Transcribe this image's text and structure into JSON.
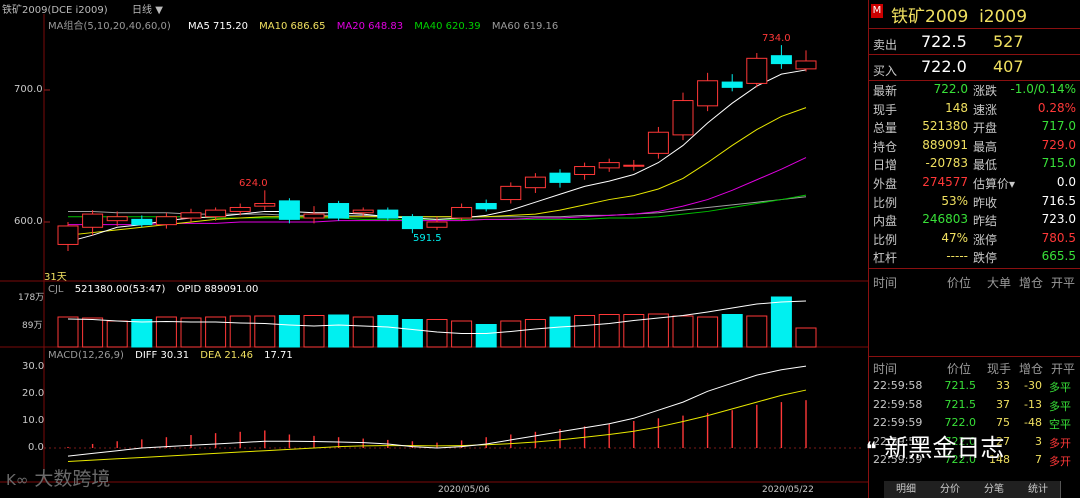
{
  "window": {
    "title": "铁矿2009(DCE i2009)",
    "period": "日线",
    "period_arrow": "▼"
  },
  "chart": {
    "ma_group": "MA组合(5,10,20,40,60,0)",
    "ma5": "MA5 715.20",
    "ma10": "MA10 686.65",
    "ma20": "MA20 648.83",
    "ma40": "MA40 620.39",
    "ma60": "MA60 619.16",
    "y_labels": [
      "700.0",
      "600.0"
    ],
    "hi_label": "734.0",
    "mark_624": "624.0",
    "low_label": "591.5",
    "days_label": "31天",
    "candles": [
      {
        "o": 583,
        "c": 597,
        "h": 600,
        "l": 578
      },
      {
        "o": 596,
        "c": 606,
        "h": 609,
        "l": 590
      },
      {
        "o": 601,
        "c": 604,
        "h": 608,
        "l": 597
      },
      {
        "o": 602,
        "c": 598,
        "h": 605,
        "l": 596
      },
      {
        "o": 598,
        "c": 604,
        "h": 607,
        "l": 595
      },
      {
        "o": 603,
        "c": 607,
        "h": 610,
        "l": 600
      },
      {
        "o": 604,
        "c": 609,
        "h": 611,
        "l": 601
      },
      {
        "o": 608,
        "c": 611,
        "h": 614,
        "l": 605
      },
      {
        "o": 612,
        "c": 614,
        "h": 624,
        "l": 609
      },
      {
        "o": 616,
        "c": 602,
        "h": 618,
        "l": 599
      },
      {
        "o": 603,
        "c": 606,
        "h": 612,
        "l": 599
      },
      {
        "o": 614,
        "c": 603,
        "h": 616,
        "l": 601
      },
      {
        "o": 607,
        "c": 609,
        "h": 611,
        "l": 604
      },
      {
        "o": 609,
        "c": 603,
        "h": 611,
        "l": 601
      },
      {
        "o": 604,
        "c": 595,
        "h": 606,
        "l": 591.5
      },
      {
        "o": 596,
        "c": 600,
        "h": 604,
        "l": 594
      },
      {
        "o": 603,
        "c": 611,
        "h": 614,
        "l": 601
      },
      {
        "o": 614,
        "c": 610,
        "h": 617,
        "l": 608
      },
      {
        "o": 617,
        "c": 627,
        "h": 630,
        "l": 614
      },
      {
        "o": 626,
        "c": 634,
        "h": 637,
        "l": 622
      },
      {
        "o": 637,
        "c": 630,
        "h": 640,
        "l": 626
      },
      {
        "o": 636,
        "c": 642,
        "h": 645,
        "l": 632
      },
      {
        "o": 641,
        "c": 645,
        "h": 648,
        "l": 638
      },
      {
        "o": 643,
        "c": 643,
        "h": 647,
        "l": 639
      },
      {
        "o": 652,
        "c": 668,
        "h": 672,
        "l": 648
      },
      {
        "o": 666,
        "c": 692,
        "h": 698,
        "l": 662
      },
      {
        "o": 688,
        "c": 707,
        "h": 713,
        "l": 684
      },
      {
        "o": 706,
        "c": 702,
        "h": 712,
        "l": 699
      },
      {
        "o": 705,
        "c": 724,
        "h": 728,
        "l": 702
      },
      {
        "o": 726,
        "c": 720,
        "h": 734,
        "l": 716
      },
      {
        "o": 716,
        "c": 722,
        "h": 730,
        "l": 714
      }
    ],
    "ma5_values": [
      585,
      590,
      596,
      598,
      601,
      603,
      604,
      606,
      608,
      608,
      607,
      607,
      606,
      604,
      603,
      602,
      603,
      605,
      609,
      615,
      621,
      627,
      631,
      636,
      645,
      658,
      675,
      690,
      703,
      712,
      715.2
    ],
    "ma10_values": [
      590,
      592,
      594,
      596,
      598,
      600,
      602,
      603,
      604,
      604,
      604,
      604,
      604,
      604,
      604,
      604,
      604,
      604,
      605,
      606,
      609,
      613,
      617,
      620,
      625,
      633,
      645,
      658,
      670,
      680,
      686.65
    ],
    "ma20_values": [
      598,
      598,
      598,
      598,
      599,
      599,
      599,
      600,
      600,
      600,
      600,
      601,
      601,
      601,
      601,
      601,
      601,
      602,
      602,
      603,
      603,
      604,
      605,
      606,
      608,
      612,
      617,
      624,
      632,
      640,
      648.83
    ],
    "ma40_values": [
      604,
      604,
      604,
      604,
      604,
      604,
      603,
      603,
      603,
      603,
      603,
      603,
      602,
      602,
      602,
      602,
      602,
      602,
      602,
      602,
      602,
      602,
      603,
      603,
      604,
      606,
      608,
      611,
      614,
      617,
      620.39
    ],
    "ma60_values": [
      608,
      608,
      607,
      607,
      607,
      606,
      606,
      606,
      606,
      605,
      605,
      605,
      605,
      604,
      604,
      604,
      604,
      604,
      604,
      604,
      604,
      605,
      605,
      606,
      607,
      609,
      611,
      613,
      615,
      617,
      619.16
    ]
  },
  "volume": {
    "label": "CJL",
    "main": "521380.00(53:47)",
    "opid": "OPID 889091.00",
    "y_labels": [
      "178万",
      "89万"
    ],
    "values": [
      60,
      58,
      52,
      55,
      60,
      58,
      60,
      62,
      62,
      63,
      63,
      64,
      60,
      63,
      55,
      55,
      52,
      45,
      52,
      55,
      60,
      63,
      65,
      65,
      66,
      62,
      60,
      65,
      62,
      100,
      38
    ],
    "opid_line": [
      56,
      55,
      52,
      50,
      51,
      50,
      50,
      48,
      47,
      44,
      42,
      44,
      42,
      40,
      35,
      30,
      27,
      27,
      31,
      36,
      40,
      43,
      47,
      53,
      58,
      63,
      70,
      78,
      86,
      90,
      92
    ]
  },
  "macd": {
    "label": "MACD(12,26,9)",
    "diff": "DIFF 30.31",
    "dea": "DEA 21.46",
    "macd": "17.71",
    "y_labels": [
      "30.0",
      "20.0",
      "10.0",
      "0.0"
    ],
    "hist": [
      0.4,
      1.5,
      2.5,
      3.2,
      4,
      4.8,
      5.5,
      6,
      6.5,
      5,
      4.5,
      4,
      3.5,
      3,
      2.5,
      2,
      2.8,
      4,
      5,
      6,
      7,
      8,
      9,
      10,
      11,
      12,
      13,
      14,
      16,
      17,
      17.71
    ],
    "diff_line": [
      -3,
      -2,
      -1,
      0,
      0.5,
      1,
      1.5,
      2,
      2.5,
      2.5,
      2.4,
      2.2,
      2,
      1.5,
      0.5,
      0,
      0.5,
      1.5,
      3,
      4.5,
      6,
      7.5,
      9,
      11,
      14,
      17,
      21,
      24,
      27,
      29,
      30.31
    ],
    "dea_line": [
      -5,
      -4.5,
      -4,
      -3.5,
      -3,
      -2.5,
      -2,
      -1.5,
      -1,
      -0.5,
      0,
      0.5,
      0.8,
      0.9,
      0.9,
      0.8,
      0.9,
      1.2,
      1.6,
      2.2,
      3,
      4,
      5,
      6.2,
      7.8,
      9.8,
      12,
      14.5,
      17,
      19.5,
      21.46
    ]
  },
  "dates": [
    "2020/05/06",
    "2020/05/22"
  ],
  "panel": {
    "flag": "M",
    "title": "铁矿2009  i2009",
    "sell_label": "卖出",
    "sell_price": "722.5",
    "sell_vol": "527",
    "buy_label": "买入",
    "buy_price": "722.0",
    "buy_vol": "407",
    "rows": [
      {
        "l1": "最新",
        "v1": "722.0",
        "c1": "g",
        "l2": "涨跌",
        "v2": "-1.0/0.14%",
        "c2": "g"
      },
      {
        "l1": "现手",
        "v1": "148",
        "c1": "y",
        "l2": "速涨",
        "v2": "0.28%",
        "c2": "r"
      },
      {
        "l1": "总量",
        "v1": "521380",
        "c1": "y",
        "l2": "开盘",
        "v2": "717.0",
        "c2": "g"
      },
      {
        "l1": "持仓",
        "v1": "889091",
        "c1": "y",
        "l2": "最高",
        "v2": "729.0",
        "c2": "r"
      },
      {
        "l1": "日增",
        "v1": "-20783",
        "c1": "y",
        "l2": "最低",
        "v2": "715.0",
        "c2": "g"
      },
      {
        "l1": "外盘",
        "v1": "274577",
        "c1": "r",
        "l2": "估算价▾",
        "v2": "0.0",
        "c2": "w"
      },
      {
        "l1": "比例",
        "v1": "53%",
        "c1": "y",
        "l2": "昨收",
        "v2": "716.5",
        "c2": "w"
      },
      {
        "l1": "内盘",
        "v1": "246803",
        "c1": "g",
        "l2": "昨结",
        "v2": "723.0",
        "c2": "w"
      },
      {
        "l1": "比例",
        "v1": "47%",
        "c1": "y",
        "l2": "涨停",
        "v2": "780.5",
        "c2": "r"
      },
      {
        "l1": "杠杆",
        "v1": "-----",
        "c1": "y",
        "l2": "跌停",
        "v2": "665.5",
        "c2": "g"
      }
    ],
    "tick_headers": [
      "时间",
      "价位",
      "大单",
      "增仓",
      "开平"
    ],
    "tick_headers2": [
      "时间",
      "价位",
      "现手",
      "增仓",
      "开平"
    ],
    "ticks": [
      {
        "t": "22:59:58",
        "p": "721.5",
        "pc": "g",
        "v": "33",
        "d": "-30",
        "o": "多平"
      },
      {
        "t": "22:59:58",
        "p": "721.5",
        "pc": "g",
        "v": "37",
        "d": "-13",
        "o": "多平"
      },
      {
        "t": "22:59:59",
        "p": "722.0",
        "pc": "g",
        "v": "75",
        "d": "-48",
        "o": "空平"
      },
      {
        "t": "22:59:59",
        "p": "722.0",
        "pc": "g",
        "v": "27",
        "d": "3",
        "o": "多开"
      },
      {
        "t": "22:59:59",
        "p": "722.0",
        "pc": "g",
        "v": "148",
        "d": "7",
        "o": "多开"
      }
    ],
    "tabs": [
      "明细",
      "分价",
      "分笔",
      "统计"
    ]
  },
  "watermark": {
    "brand1": "新黑金日志",
    "brand2": "大数跨境"
  },
  "colors": {
    "up": "#ff3838",
    "down": "#00f0f0",
    "ma5": "#ffffff",
    "ma10": "#e8e800",
    "ma20": "#e000e0",
    "ma40": "#00c000",
    "ma60": "#a0a0a0",
    "grid": "#7a0a0a"
  }
}
